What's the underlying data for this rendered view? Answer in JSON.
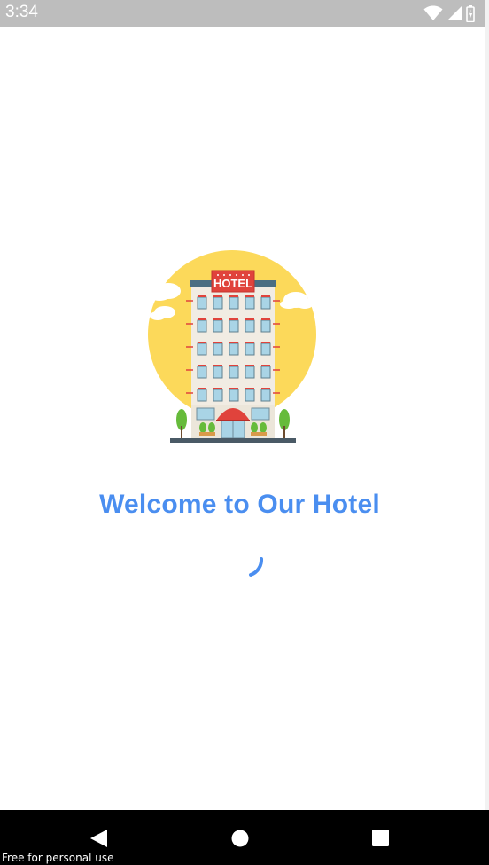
{
  "status_bar": {
    "time": "3:34",
    "icons": [
      "wifi-icon",
      "signal-icon",
      "battery-icon"
    ]
  },
  "splash": {
    "title": "Welcome to Our Hotel",
    "illustration_sign": "HOTEL",
    "spinner": "loading-spinner"
  },
  "nav_bar": {
    "buttons": [
      "back-icon",
      "home-icon",
      "recents-icon"
    ],
    "watermark": "Free for personal use"
  },
  "colors": {
    "accent": "#4a8ef0",
    "status_bar": "#bdbdbd",
    "nav_bar": "#000000",
    "sun": "#fcd95a",
    "sign": "#e0433c"
  }
}
